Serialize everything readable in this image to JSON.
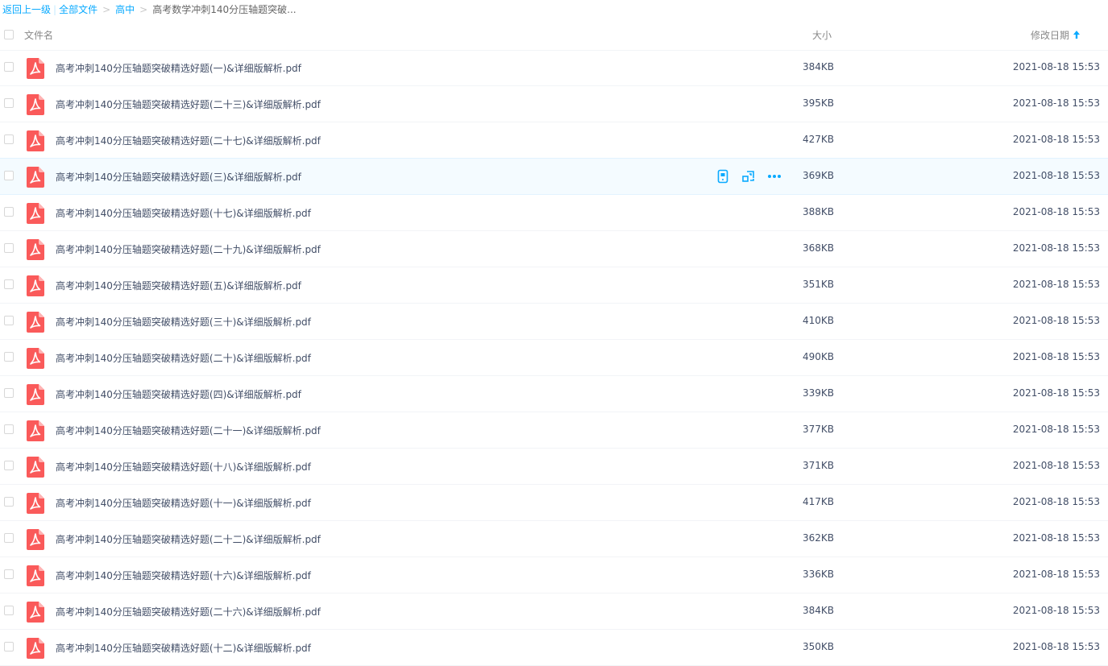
{
  "breadcrumb": {
    "back": "返回上一级",
    "all_files": "全部文件",
    "high_school": "高中",
    "current": "高考数学冲刺140分压轴题突破..."
  },
  "header": {
    "name": "文件名",
    "size": "大小",
    "date": "修改日期"
  },
  "colors": {
    "accent": "#09aaff",
    "pdf_red": "#fa5a5a",
    "hover_bg": "#f4fbff"
  },
  "icons": {
    "file": "pdf-file-icon",
    "sort": "arrow-up-icon",
    "row_actions": [
      "phone-icon",
      "share-icon",
      "more-icon"
    ]
  },
  "files": [
    {
      "name": "高考冲刺140分压轴题突破精选好题(一)&详细版解析.pdf",
      "size": "384KB",
      "date": "2021-08-18 15:53"
    },
    {
      "name": "高考冲刺140分压轴题突破精选好题(二十三)&详细版解析.pdf",
      "size": "395KB",
      "date": "2021-08-18 15:53"
    },
    {
      "name": "高考冲刺140分压轴题突破精选好题(二十七)&详细版解析.pdf",
      "size": "427KB",
      "date": "2021-08-18 15:53"
    },
    {
      "name": "高考冲刺140分压轴题突破精选好题(三)&详细版解析.pdf",
      "size": "369KB",
      "date": "2021-08-18 15:53"
    },
    {
      "name": "高考冲刺140分压轴题突破精选好题(十七)&详细版解析.pdf",
      "size": "388KB",
      "date": "2021-08-18 15:53"
    },
    {
      "name": "高考冲刺140分压轴题突破精选好题(二十九)&详细版解析.pdf",
      "size": "368KB",
      "date": "2021-08-18 15:53"
    },
    {
      "name": "高考冲刺140分压轴题突破精选好题(五)&详细版解析.pdf",
      "size": "351KB",
      "date": "2021-08-18 15:53"
    },
    {
      "name": "高考冲刺140分压轴题突破精选好题(三十)&详细版解析.pdf",
      "size": "410KB",
      "date": "2021-08-18 15:53"
    },
    {
      "name": "高考冲刺140分压轴题突破精选好题(二十)&详细版解析.pdf",
      "size": "490KB",
      "date": "2021-08-18 15:53"
    },
    {
      "name": "高考冲刺140分压轴题突破精选好题(四)&详细版解析.pdf",
      "size": "339KB",
      "date": "2021-08-18 15:53"
    },
    {
      "name": "高考冲刺140分压轴题突破精选好题(二十一)&详细版解析.pdf",
      "size": "377KB",
      "date": "2021-08-18 15:53"
    },
    {
      "name": "高考冲刺140分压轴题突破精选好题(十八)&详细版解析.pdf",
      "size": "371KB",
      "date": "2021-08-18 15:53"
    },
    {
      "name": "高考冲刺140分压轴题突破精选好题(十一)&详细版解析.pdf",
      "size": "417KB",
      "date": "2021-08-18 15:53"
    },
    {
      "name": "高考冲刺140分压轴题突破精选好题(二十二)&详细版解析.pdf",
      "size": "362KB",
      "date": "2021-08-18 15:53"
    },
    {
      "name": "高考冲刺140分压轴题突破精选好题(十六)&详细版解析.pdf",
      "size": "336KB",
      "date": "2021-08-18 15:53"
    },
    {
      "name": "高考冲刺140分压轴题突破精选好题(二十六)&详细版解析.pdf",
      "size": "384KB",
      "date": "2021-08-18 15:53"
    },
    {
      "name": "高考冲刺140分压轴题突破精选好题(十二)&详细版解析.pdf",
      "size": "350KB",
      "date": "2021-08-18 15:53"
    }
  ],
  "hovered_index": 3
}
